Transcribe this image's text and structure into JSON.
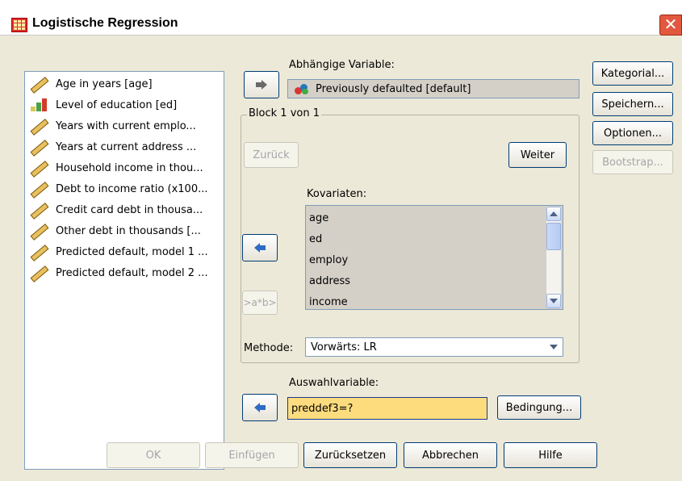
{
  "window": {
    "title": "Logistische Regression",
    "close_glyph": "✕"
  },
  "variables": [
    {
      "label": "Age in years [age]",
      "icon": "scale-ruler-icon"
    },
    {
      "label": "Level of education [ed]",
      "icon": "ordinal-bars-icon"
    },
    {
      "label": "Years with current emplo...",
      "icon": "scale-ruler-icon"
    },
    {
      "label": "Years at current address ...",
      "icon": "scale-ruler-icon"
    },
    {
      "label": "Household income in thou...",
      "icon": "scale-ruler-icon"
    },
    {
      "label": "Debt to income ratio (x100...",
      "icon": "scale-ruler-icon"
    },
    {
      "label": "Credit card debt in thousa...",
      "icon": "scale-ruler-icon"
    },
    {
      "label": "Other debt in thousands [...",
      "icon": "scale-ruler-icon"
    },
    {
      "label": "Predicted default, model 1 ...",
      "icon": "scale-ruler-icon"
    },
    {
      "label": "Predicted default, model 2 ...",
      "icon": "scale-ruler-icon"
    }
  ],
  "dependent": {
    "label": "Abhängige Variable:",
    "value": "Previously defaulted [default]",
    "icon": "nominal-people-icon"
  },
  "block": {
    "title": "Block 1 von 1",
    "back_label": "Zurück",
    "next_label": "Weiter"
  },
  "covariates": {
    "label": "Kovariaten:",
    "items": [
      "age",
      "ed",
      "employ",
      "address",
      "income"
    ]
  },
  "interaction_label": ">a*b>",
  "method": {
    "label": "Methode:",
    "value": "Vorwärts: LR"
  },
  "selection": {
    "label": "Auswahlvariable:",
    "value": "preddef3=?",
    "rule_label": "Bedingung..."
  },
  "side_buttons": {
    "categorical": "Kategorial...",
    "save": "Speichern...",
    "options": "Optionen...",
    "bootstrap": "Bootstrap..."
  },
  "bottom_buttons": {
    "ok": "OK",
    "paste": "Einfügen",
    "reset": "Zurücksetzen",
    "cancel": "Abbrechen",
    "help": "Hilfe"
  },
  "colors": {
    "dialog_bg": "#ece9d8",
    "selection_field": "#fddc7e",
    "close_button": "#e2583e",
    "accent_border": "#003c74"
  }
}
